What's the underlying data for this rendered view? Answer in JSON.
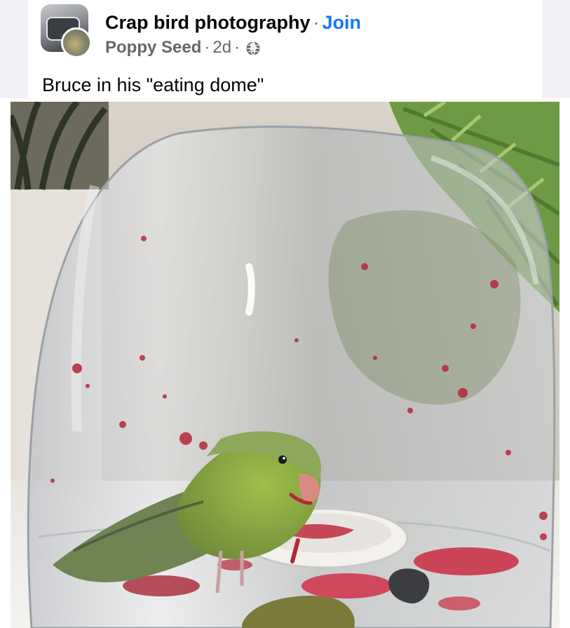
{
  "post": {
    "group_name": "Crap bird photography",
    "separator": "·",
    "join_label": "Join",
    "author": "Poppy Seed",
    "time": "2d",
    "privacy_icon": "globe-icon",
    "caption": "Bruce in his \"eating dome\""
  },
  "colors": {
    "link_blue": "#1877f2",
    "meta_gray": "#65676b",
    "text_black": "#050505"
  }
}
